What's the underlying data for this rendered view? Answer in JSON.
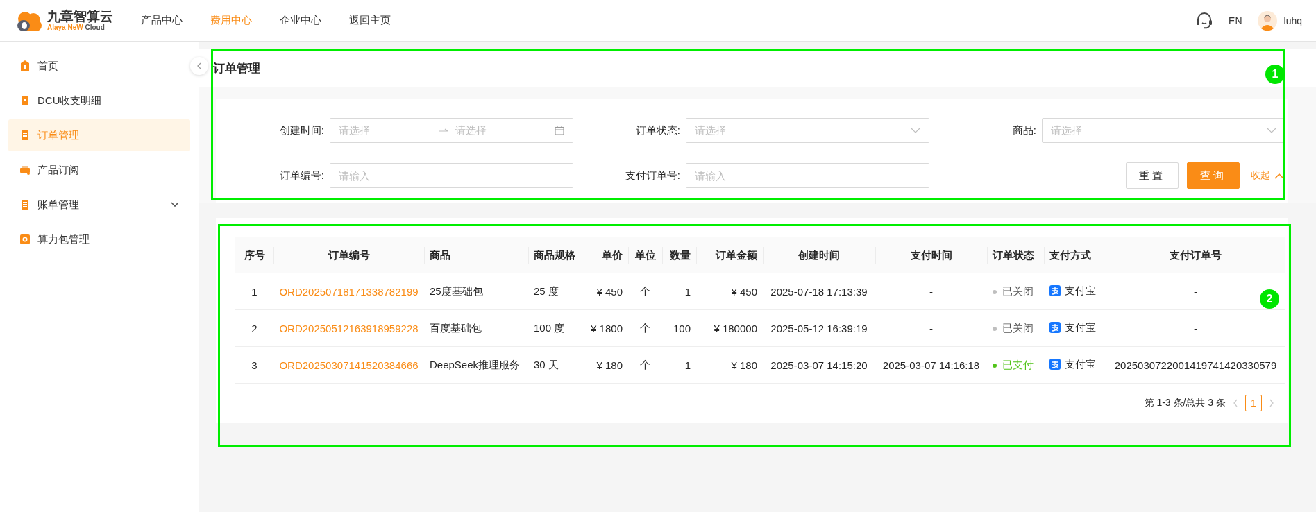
{
  "header": {
    "logo": {
      "name": "九章智算云",
      "tagline_brand": "Alaya NeW",
      "tagline_suffix": "Cloud"
    },
    "nav": [
      {
        "label": "产品中心",
        "selected": false
      },
      {
        "label": "费用中心",
        "selected": true
      },
      {
        "label": "企业中心",
        "selected": false
      },
      {
        "label": "返回主页",
        "selected": false
      }
    ],
    "language": "EN",
    "user": "luhq"
  },
  "sidebar": {
    "items": [
      {
        "label": "首页",
        "selected": false,
        "kind": "link"
      },
      {
        "label": "DCU收支明细",
        "selected": false,
        "kind": "link"
      },
      {
        "label": "订单管理",
        "selected": true,
        "kind": "link"
      },
      {
        "label": "产品订阅",
        "selected": false,
        "kind": "link"
      },
      {
        "label": "账单管理",
        "selected": false,
        "kind": "group",
        "expanded": false
      },
      {
        "label": "算力包管理",
        "selected": false,
        "kind": "link"
      }
    ]
  },
  "page_title": "订单管理",
  "filters": [
    {
      "label": "创建时间:",
      "kind": "date-range",
      "placeholder": "请选择",
      "placeholder_end": "请选择"
    },
    {
      "label": "订单状态:",
      "kind": "select",
      "placeholder": "请选择"
    },
    {
      "label": "商品:",
      "kind": "select",
      "placeholder": "请选择"
    },
    {
      "label": "订单编号:",
      "kind": "input",
      "placeholder": "请输入"
    },
    {
      "label": "支付订单号:",
      "kind": "input",
      "placeholder": "请输入"
    }
  ],
  "filter_actions": {
    "reset": "重置",
    "query": "查询",
    "collapse": "收起"
  },
  "table": {
    "columns": [
      "序号",
      "订单编号",
      "商品",
      "商品规格",
      "单价",
      "单位",
      "数量",
      "订单金额",
      "创建时间",
      "支付时间",
      "订单状态",
      "支付方式",
      "支付订单号"
    ],
    "rows": [
      {
        "index": "1",
        "order_no": "ORD20250718171338782199",
        "product": "25度基础包",
        "spec": "25 度",
        "unit_price": "¥ 450",
        "unit": "个",
        "quantity": "1",
        "amount": "¥ 450",
        "created_at": "2025-07-18 17:13:39",
        "paid_at": "-",
        "status": {
          "text": "已关闭",
          "kind": "closed",
          "color": "#bfbfbf"
        },
        "payment": "支付宝",
        "payment_order_no": "-"
      },
      {
        "index": "2",
        "order_no": "ORD20250512163918959228",
        "product": "百度基础包",
        "spec": "100 度",
        "unit_price": "¥ 1800",
        "unit": "个",
        "quantity": "100",
        "amount": "¥ 180000",
        "created_at": "2025-05-12 16:39:19",
        "paid_at": "-",
        "status": {
          "text": "已关闭",
          "kind": "closed",
          "color": "#bfbfbf"
        },
        "payment": "支付宝",
        "payment_order_no": "-"
      },
      {
        "index": "3",
        "order_no": "ORD20250307141520384666",
        "product": "DeepSeek推理服务",
        "spec": "30 天",
        "unit_price": "¥ 180",
        "unit": "个",
        "quantity": "1",
        "amount": "¥ 180",
        "created_at": "2025-03-07 14:15:20",
        "paid_at": "2025-03-07 14:16:18",
        "status": {
          "text": "已支付",
          "kind": "paid",
          "color": "#52c41a"
        },
        "payment": "支付宝",
        "payment_order_no": "2025030722001419741420330579"
      }
    ]
  },
  "pagination": {
    "summary": "第 1-3 条/总共 3 条",
    "pages": [
      {
        "label": "1",
        "selected": true
      }
    ]
  },
  "annotations": [
    {
      "label": "1"
    },
    {
      "label": "2"
    }
  ]
}
